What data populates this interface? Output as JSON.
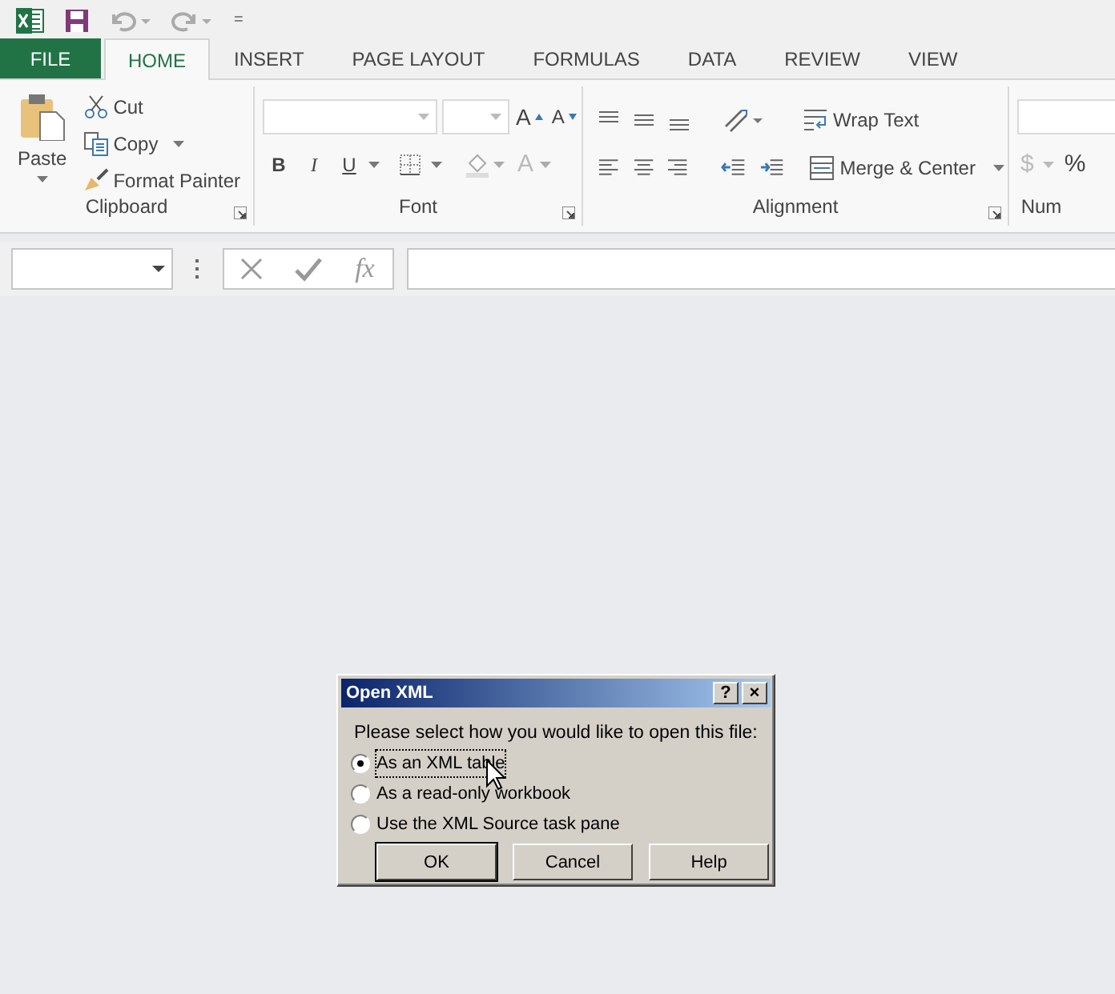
{
  "quick_access": {
    "customize": "="
  },
  "tabs": [
    {
      "label": "FILE",
      "kind": "file",
      "selected": false
    },
    {
      "label": "HOME",
      "kind": "tab",
      "selected": true
    },
    {
      "label": "INSERT",
      "kind": "tab",
      "selected": false
    },
    {
      "label": "PAGE LAYOUT",
      "kind": "tab",
      "selected": false
    },
    {
      "label": "FORMULAS",
      "kind": "tab",
      "selected": false
    },
    {
      "label": "DATA",
      "kind": "tab",
      "selected": false
    },
    {
      "label": "REVIEW",
      "kind": "tab",
      "selected": false
    },
    {
      "label": "VIEW",
      "kind": "tab",
      "selected": false
    }
  ],
  "ribbon": {
    "clipboard": {
      "title": "Clipboard",
      "paste": "Paste",
      "cut": "Cut",
      "copy": "Copy",
      "format_painter": "Format Painter"
    },
    "font": {
      "title": "Font",
      "bold": "B",
      "italic": "I",
      "underline": "U",
      "grow": "A",
      "shrink": "A",
      "font_color": "A"
    },
    "alignment": {
      "title": "Alignment",
      "wrap_text": "Wrap Text",
      "merge_center": "Merge & Center"
    },
    "number": {
      "title": "Num",
      "currency": "$",
      "percent": "%"
    }
  },
  "formula_bar": {
    "function_label": "fx"
  },
  "dialog": {
    "title": "Open XML",
    "help": "?",
    "close": "×",
    "prompt": "Please select how you would like to open this file:",
    "options": [
      {
        "label": "As an XML table",
        "selected": true
      },
      {
        "label": "As a read-only workbook",
        "selected": false
      },
      {
        "label": "Use the XML Source task pane",
        "selected": false
      }
    ],
    "buttons": [
      {
        "label": "OK",
        "default": true
      },
      {
        "label": "Cancel",
        "default": false
      },
      {
        "label": "Help",
        "default": false
      }
    ]
  }
}
